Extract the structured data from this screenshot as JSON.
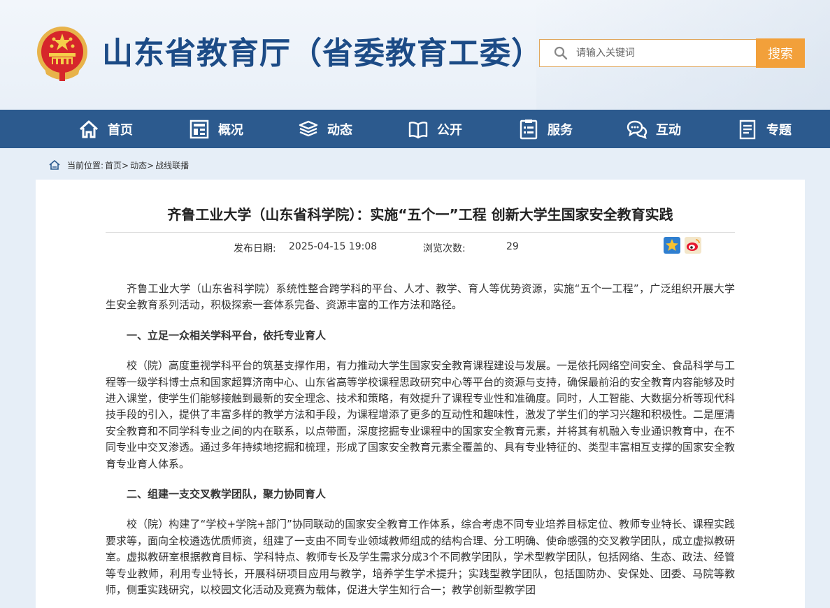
{
  "header": {
    "site_title": "山东省教育厅（省委教育工委）",
    "search_placeholder": "请输入关键词",
    "search_button": "搜索"
  },
  "nav": {
    "items": [
      {
        "label": "首页",
        "icon": "home-icon"
      },
      {
        "label": "概况",
        "icon": "building-icon"
      },
      {
        "label": "动态",
        "icon": "news-stack-icon"
      },
      {
        "label": "公开",
        "icon": "open-book-icon"
      },
      {
        "label": "服务",
        "icon": "service-list-icon"
      },
      {
        "label": "互动",
        "icon": "chat-bubbles-icon"
      },
      {
        "label": "专题",
        "icon": "document-icon"
      }
    ]
  },
  "breadcrumb": {
    "prefix": "当前位置:",
    "items": [
      "首页>",
      "动态>",
      "战线联播"
    ]
  },
  "article": {
    "title": "齐鲁工业大学（山东省科学院）：实施“五个一”工程 创新大学生国家安全教育实践",
    "date_label": "发布日期:",
    "date_value": "2025-04-15 19:08",
    "views_label": "浏览次数:",
    "views_value": "29",
    "paragraphs": [
      "齐鲁工业大学（山东省科学院）系统性整合跨学科的平台、人才、教学、育人等优势资源，实施“五个一工程”，广泛组织开展大学生安全教育系列活动，积极探索一套体系完备、资源丰富的工作方法和路径。",
      "一、立足一众相关学科平台，依托专业育人",
      "校（院）高度重视学科平台的筑基支撑作用，有力推动大学生国家安全教育课程建设与发展。一是依托网络空间安全、食品科学与工程等一级学科博士点和国家超算济南中心、山东省高等学校课程思政研究中心等平台的资源与支持，确保最前沿的安全教育内容能够及时进入课堂，使学生们能够接触到最新的安全理念、技术和策略，有效提升了课程专业性和准确度。同时，人工智能、大数据分析等现代科技手段的引入，提供了丰富多样的教学方法和手段，为课程增添了更多的互动性和趣味性，激发了学生们的学习兴趣和积极性。二是厘清安全教育和不同学科专业之间的内在联系，以点带面，深度挖掘专业课程中的国家安全教育元素，并将其有机融入专业通识教育中，在不同专业中交叉渗透。通过多年持续地挖掘和梳理，形成了国家安全教育元素全覆盖的、具有专业特征的、类型丰富相互支撑的国家安全教育专业育人体系。",
      "二、组建一支交叉教学团队，聚力协同育人",
      "校（院）构建了“学校+学院+部门”协同联动的国家安全教育工作体系，综合考虑不同专业培养目标定位、教师专业特长、课程实践要求等，面向全校遴选优质师资，组建了一支由不同专业领域教师组成的结构合理、分工明确、使命感强的交叉教学团队，成立虚拟教研室。虚拟教研室根据教育目标、学科特点、教师专长及学生需求分成3个不同教学团队，学术型教学团队，包括网络、生态、政法、经管等专业教师，利用专业特长，开展科研项目应用与教学，培养学生学术提升；实践型教学团队，包括国防办、安保处、团委、马院等教师，侧重实践研究，以校园文化活动及竞赛为载体，促进大学生知行合一；教学创新型教学团"
    ]
  },
  "colors": {
    "title_blue": "#1c4b86",
    "nav_blue": "#2c5a8e",
    "search_orange": "#f2a03a"
  }
}
